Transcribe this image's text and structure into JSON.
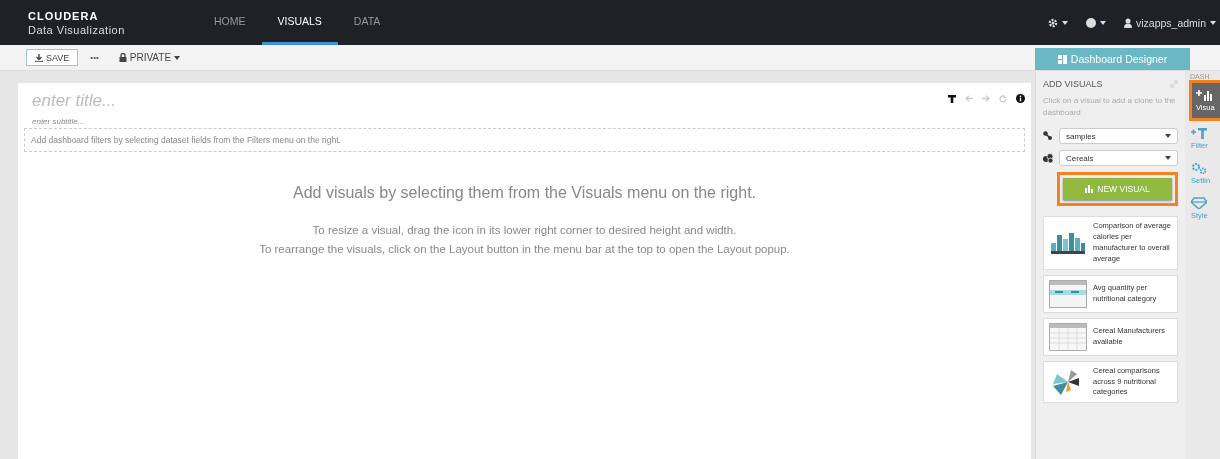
{
  "brand": {
    "name": "CLOUDERA",
    "product": "Data Visualization"
  },
  "nav_tabs": [
    {
      "label": "HOME",
      "selected": false
    },
    {
      "label": "VISUALS",
      "selected": true
    },
    {
      "label": "DATA",
      "selected": false
    }
  ],
  "user_menu": {
    "username": "vizapps_admin"
  },
  "toolbar": {
    "save": "SAVE",
    "more": "•••",
    "privacy": "PRIVATE"
  },
  "dashboard": {
    "title_placeholder": "enter title...",
    "subtitle_placeholder": "enter subtitle...",
    "filter_hint": "Add dashboard filters by selecting dataset fields from the Filters menu on the right.",
    "empty_heading": "Add visuals by selecting them from the Visuals menu on the right.",
    "empty_help": [
      "To resize a visual, drag the icon in its lower right corner to desired height and width.",
      "To rearrange the visuals, click on the Layout button in the menu bar at the top to open the Layout popup."
    ]
  },
  "designer_button": "Dashboard Designer",
  "add_visuals": {
    "title": "ADD VISUALS",
    "hint": "Click on a visual to add a clone to the dashboard",
    "connection": "samples",
    "dataset": "Cereals",
    "new_visual": "NEW VISUAL",
    "new_visual_highlighted": true,
    "visuals": [
      {
        "kind": "bars",
        "label": "Comparison of average calories per manufacturer to overall average"
      },
      {
        "kind": "crosstab",
        "label": "Avg quantity per nutritional category"
      },
      {
        "kind": "table",
        "label": "Cereal Manufacturers available"
      },
      {
        "kind": "radial",
        "label": "Cereal comparisons across 9 nutritional categories"
      }
    ]
  },
  "rail": {
    "heading": "DASH",
    "items": [
      {
        "kind": "visuals",
        "label": "Visua",
        "selected": true,
        "highlighted": true
      },
      {
        "kind": "filters",
        "label": "Filter",
        "selected": false,
        "highlighted": false
      },
      {
        "kind": "settings",
        "label": "Settin",
        "selected": false,
        "highlighted": false
      },
      {
        "kind": "style",
        "label": "Style",
        "selected": false,
        "highlighted": false
      }
    ]
  }
}
